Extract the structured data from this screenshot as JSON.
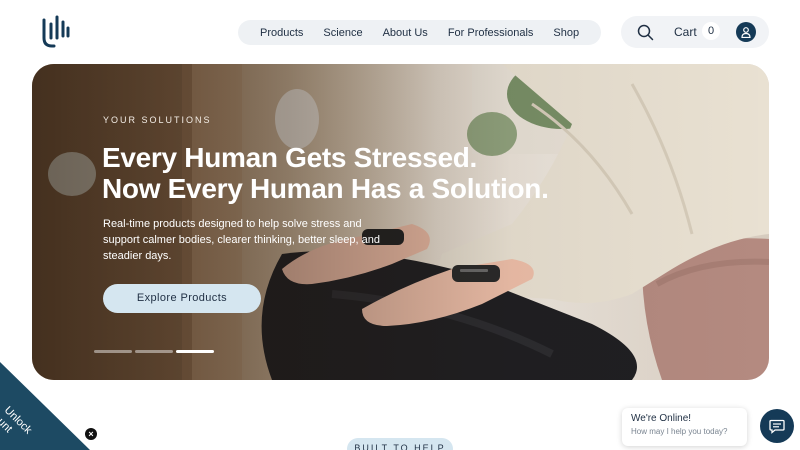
{
  "header": {
    "logo_icon": "hand-logo-icon",
    "nav": [
      "Products",
      "Science",
      "About Us",
      "For Professionals",
      "Shop"
    ],
    "search_icon": "search-icon",
    "cart_label": "Cart",
    "cart_count": "0",
    "account_icon": "user-icon"
  },
  "hero": {
    "eyebrow": "YOUR SOLUTIONS",
    "headline_line1": "Every Human Gets Stressed.",
    "headline_line2": "Now Every Human Has a Solution.",
    "subtext": "Real-time products designed to help solve stress and support calmer bodies, clearer thinking, better sleep, and steadier days.",
    "cta_label": "Explore Products",
    "slides_total": 3,
    "active_slide": 3
  },
  "discount": {
    "label_line1": "Unlock",
    "label_line2": "Discount",
    "close_symbol": "×"
  },
  "section": {
    "pill_label": "BUILT TO HELP"
  },
  "chat": {
    "title": "We're Online!",
    "subtitle": "How may I help you today?",
    "icon": "chat-icon"
  },
  "colors": {
    "navy": "#153a57",
    "pill_blue": "#d5e6f0",
    "discount_teal": "#1d4a63"
  }
}
